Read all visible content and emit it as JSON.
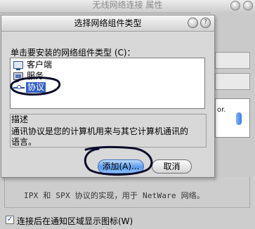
{
  "background_window": {
    "title": "无线网络连接 属性",
    "protocol_description": "IPX 和 SPX 协议的实现，用于 NetWare 网络。",
    "notify_icon_checkbox": {
      "label": "连接后在通知区域显示图标(W)",
      "checked": true
    },
    "list_fragment": "or."
  },
  "dialog": {
    "title": "选择网络组件类型",
    "prompt": "单击要安装的网络组件类型 (C)：",
    "component_types": [
      {
        "label": "客户端",
        "icon": "client-icon",
        "selected": false
      },
      {
        "label": "服务",
        "icon": "service-icon",
        "selected": false
      },
      {
        "label": "协议",
        "icon": "protocol-icon",
        "selected": true
      }
    ],
    "description_label": "描述",
    "description_lines": [
      "通讯协议是您的计算机用来与其它计算机通讯的",
      "语言。"
    ],
    "add_button": "添加(A)...",
    "cancel_button": "取消",
    "help_button": "?"
  },
  "colors": {
    "selection": "#3661c4",
    "default_button": "#5b9bea",
    "ink_annotation": "#0b0b2a"
  }
}
